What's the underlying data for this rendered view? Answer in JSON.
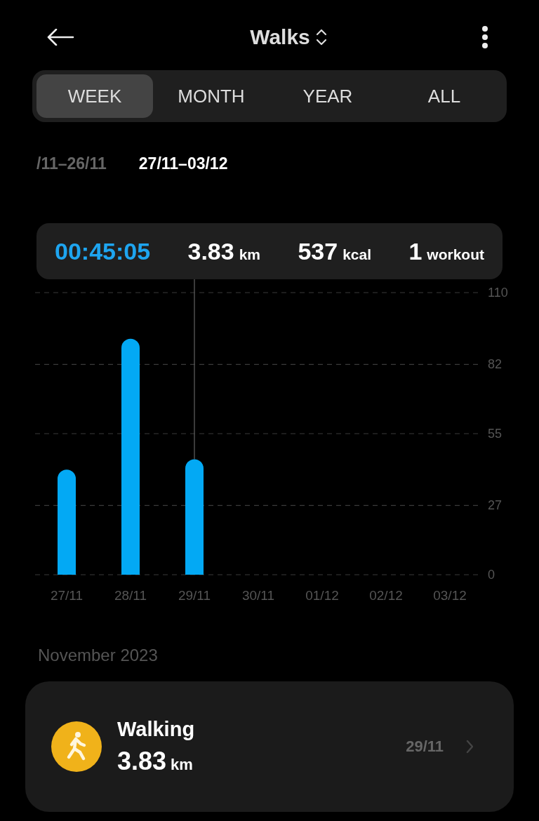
{
  "header": {
    "title": "Walks"
  },
  "tabs": [
    {
      "label": "WEEK",
      "selected": true
    },
    {
      "label": "MONTH",
      "selected": false
    },
    {
      "label": "YEAR",
      "selected": false
    },
    {
      "label": "ALL",
      "selected": false
    }
  ],
  "periods": [
    {
      "label": "/11–26/11",
      "selected": false
    },
    {
      "label": "27/11–03/12",
      "selected": true
    }
  ],
  "summary": {
    "duration": "00:45:05",
    "distance": "3.83",
    "distance_unit": "km",
    "calories": "537",
    "calories_unit": "kcal",
    "workouts": "1",
    "workouts_unit": "workout"
  },
  "chart_data": {
    "type": "bar",
    "categories": [
      "27/11",
      "28/11",
      "29/11",
      "30/11",
      "01/12",
      "02/12",
      "03/12"
    ],
    "series": [
      {
        "color": "#03a9f4",
        "values": [
          41,
          92,
          45,
          null,
          null,
          null,
          null
        ]
      }
    ],
    "ylim": [
      0,
      110
    ],
    "yticks": [
      0,
      27,
      55,
      82,
      110
    ],
    "grid": true
  },
  "month_label": "November 2023",
  "workouts": [
    {
      "name": "Walking",
      "distance": "3.83",
      "unit": "km",
      "date": "29/11"
    }
  ]
}
